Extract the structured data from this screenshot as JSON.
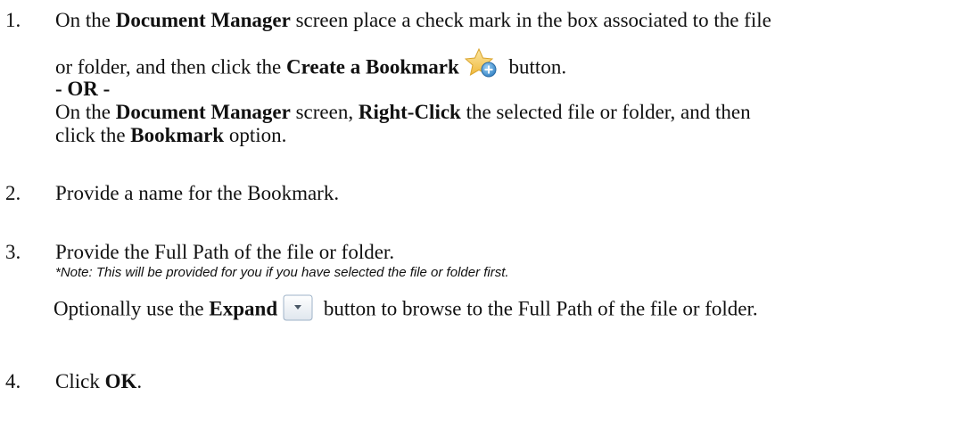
{
  "steps": [
    {
      "number": "1.",
      "line1": {
        "t1": "On the ",
        "b1": "Document Manager",
        "t2": " screen place a check mark in the box associated to the file"
      },
      "line2": {
        "t1": "or folder, and then click the ",
        "b1": "Create a Bookmark",
        "icon": "bookmark-star-icon",
        "t2": " button."
      },
      "or_label": "- OR -",
      "line3": {
        "t1": "On the ",
        "b1": "Document Manager",
        "t2": " screen, ",
        "b2": "Right-Click",
        "t3": " the selected file or folder, and then"
      },
      "line4": {
        "t1": "click the ",
        "b1": "Bookmark",
        "t2": " option."
      }
    },
    {
      "number": "2.",
      "text": "Provide a name for the Bookmark."
    },
    {
      "number": "3.",
      "text": "Provide the Full Path of the file or folder.",
      "note": "*Note: This will be provided for you if you have selected the file or folder first.",
      "line": {
        "t1": "Optionally use the ",
        "b1": "Expand",
        "icon": "expand-dropdown-icon",
        "t2": " button to browse to the Full Path of the file or folder."
      }
    },
    {
      "number": "4.",
      "t1": "Click ",
      "b1": "OK",
      "t2": "."
    }
  ],
  "colors": {
    "text": "#111111",
    "star_gold": "#f2c04a",
    "bookmark_blue": "#3a8fd0",
    "expand_button_border": "#9fb3c8"
  }
}
